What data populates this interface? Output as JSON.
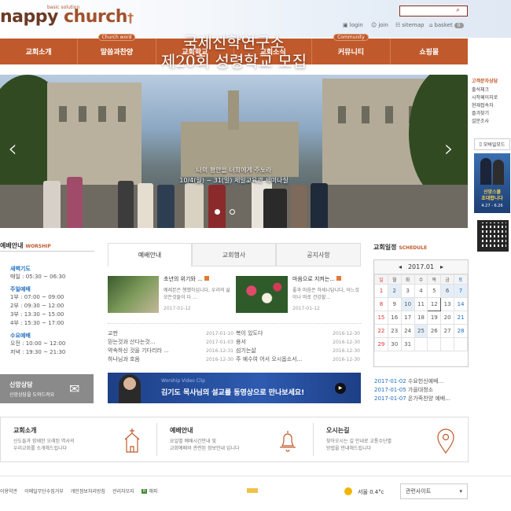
{
  "header": {
    "logo_sub": "basic solution",
    "logo_a": "nappy",
    "logo_b": " church",
    "logo_cross": "†",
    "util": [
      {
        "label": "login",
        "icon": "lock-icon"
      },
      {
        "label": "join",
        "icon": "user-icon"
      },
      {
        "label": "sitemap",
        "icon": "sitemap-icon"
      },
      {
        "label": "basket",
        "icon": "basket-icon",
        "count": "0"
      }
    ]
  },
  "nav": [
    {
      "label": "교회소개",
      "tag": ""
    },
    {
      "label": "말씀과찬양",
      "tag": "Church word"
    },
    {
      "label": "교회학교",
      "tag": ""
    },
    {
      "label": "교회소식",
      "tag": ""
    },
    {
      "label": "커뮤니티",
      "tag": "Community"
    },
    {
      "label": "쇼핑몰",
      "tag": ""
    }
  ],
  "hero": {
    "title1": "국제신학연구소",
    "title2": "제20회 성령학교 모집",
    "sub1": "나의 평안을 너희에게 주노라",
    "sub2": "10/4(월) ~ 31(일) 제일교육관 세미나실"
  },
  "right_sidebar": {
    "title": "고객문자상담",
    "links": [
      "출석체크",
      "시작페이지로",
      "현재접속자",
      "즐겨찾기",
      "설문조사"
    ],
    "mobile": "모바일모드",
    "banner_t1": "신앙스쿨",
    "banner_t2": "초대합니다",
    "banner_date": "4.27 - 6.26"
  },
  "worship": {
    "title": "예배안내",
    "title_en": "WORSHIP",
    "groups": [
      {
        "head": "새벽기도",
        "rows": [
          "매일 : 05:30 ~ 06:30"
        ]
      },
      {
        "head": "주일예배",
        "rows": [
          "1부 : 07:00 ~ 09:00",
          "2부 : 09:30 ~ 12:00",
          "3부 : 13:30 ~ 15:00",
          "4부 : 15:30 ~ 17:00"
        ]
      },
      {
        "head": "수요예배",
        "rows": [
          "오전 : 10:00 ~ 12:00",
          "저녁 : 19:30 ~ 21:30"
        ]
      }
    ],
    "counsel_title": "신앙상담",
    "counsel_desc": "신앙상담을 도와드려요"
  },
  "tabs": [
    "예배안내",
    "교회행사",
    "공지사항"
  ],
  "featured": [
    {
      "title": "초년의 위기와 ...",
      "desc": "예레본은 행했하십니다, 우리의 삶 모든것들이 다 ...",
      "date": "2017-01-12"
    },
    {
      "title": "마음으로 지켜는...",
      "desc": "좋과 마음은 하세니답니다, 어느것이나 따로 건강할...",
      "date": "2017-01-12"
    }
  ],
  "list_left": [
    {
      "t": "교판",
      "d": "2017-01-10"
    },
    {
      "t": "믿는것과 산다는것...",
      "d": "2017-01-03"
    },
    {
      "t": "약속하신 것을 기다리라 ...",
      "d": "2016-12-31"
    },
    {
      "t": "하나님과 호음",
      "d": "2016-12-30"
    }
  ],
  "list_right": [
    {
      "t": "복이 있도다",
      "d": "2016-12-30"
    },
    {
      "t": "용서",
      "d": "2016-12-30"
    },
    {
      "t": "섬기는삶",
      "d": "2016-12-30"
    },
    {
      "t": "주 예수여 어서 오시옵소서...",
      "d": "2016-12-30"
    }
  ],
  "video": {
    "tag": "Worship Video Clip",
    "text": "김기도 목사님의 설교를 동영상으로 만나보세요!"
  },
  "schedule": {
    "title": "교회일정",
    "title_en": "SCHEDULE",
    "month": "2017.01",
    "days": [
      "일",
      "월",
      "화",
      "수",
      "목",
      "금",
      "토"
    ],
    "weeks": [
      [
        "1",
        "2",
        "3",
        "4",
        "5",
        "6",
        "7"
      ],
      [
        "8",
        "9",
        "10",
        "11",
        "12",
        "13",
        "14"
      ],
      [
        "15",
        "16",
        "17",
        "18",
        "19",
        "20",
        "21"
      ],
      [
        "22",
        "23",
        "24",
        "25",
        "26",
        "27",
        "28"
      ],
      [
        "29",
        "30",
        "31",
        "",
        "",
        "",
        ""
      ]
    ],
    "events": [
      {
        "d": "2017-01-02",
        "t": "수요헌신예배..."
      },
      {
        "d": "2017-01-05",
        "t": "가을대청소"
      },
      {
        "d": "2017-01-07",
        "t": "온가족찬양 예배..."
      }
    ]
  },
  "cards": [
    {
      "title": "교회소개",
      "desc1": "신도들과 함께한 오래된 역사의",
      "desc2": "우리교회를 소개해드립니다",
      "icon": "church-icon"
    },
    {
      "title": "예배안내",
      "desc1": "요일별 예배시간안내 및",
      "desc2": "교회예배와 관련된 정보안내 입니다",
      "icon": "bell-icon"
    },
    {
      "title": "오시는길",
      "desc1": "찾아오시는 길 안내로 교통수단별",
      "desc2": "방법을 안내해드립니다",
      "icon": "location-pin-icon"
    }
  ],
  "footer": {
    "links": [
      "이용약관",
      "이메일무단수집거부",
      "개인정보처리방침",
      "관리자모지",
      "해피"
    ],
    "weather": "서울 0.4°c",
    "select": "관련사이트"
  },
  "colors": {
    "brand": "#c05a2c",
    "brown": "#6b3a26",
    "blue": "#1f6ec0"
  }
}
